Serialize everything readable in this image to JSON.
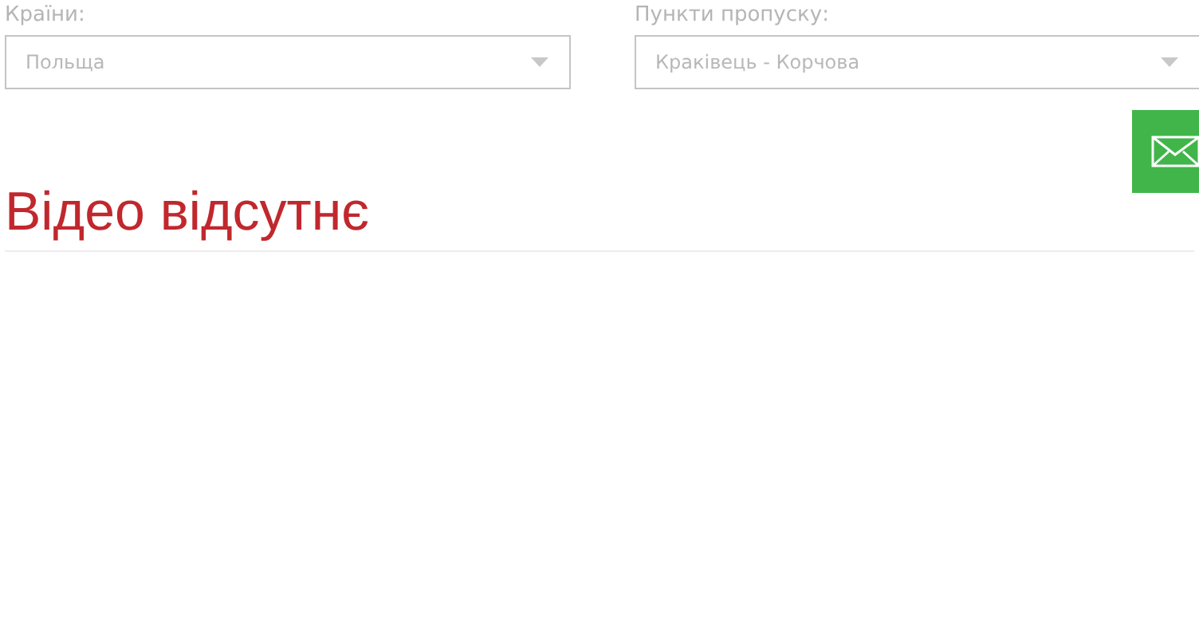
{
  "filters": [
    {
      "label": "Країни:",
      "value": "Польща"
    },
    {
      "label": "Пункти пропуску:",
      "value": "Краківець - Корчова"
    }
  ],
  "message": "Відео відсутнє"
}
